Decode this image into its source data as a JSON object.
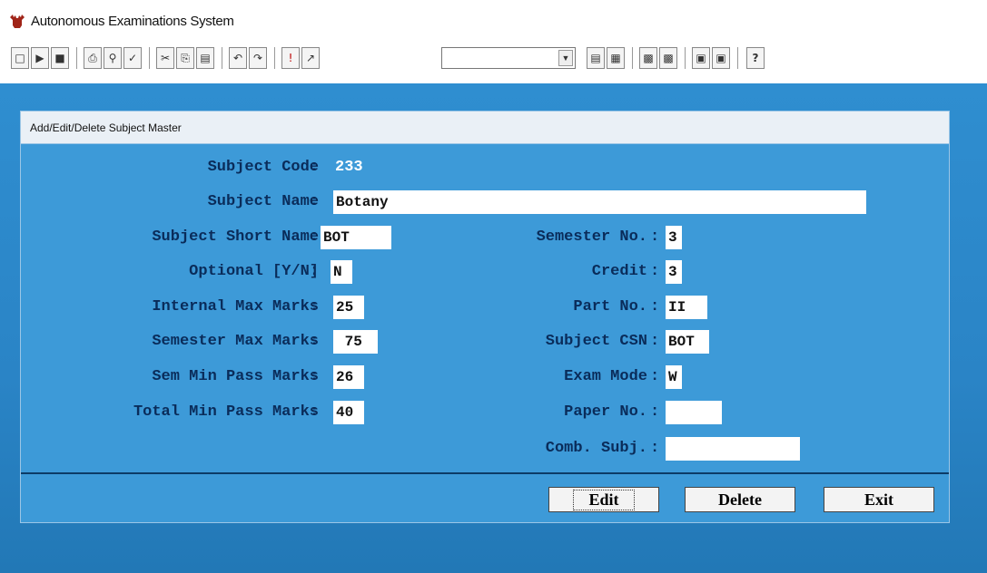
{
  "app": {
    "title": "Autonomous Examinations System",
    "icon": "moose-app-icon"
  },
  "toolbar": {
    "buttons": [
      {
        "name": "new-icon",
        "glyph": "🗋"
      },
      {
        "name": "open-icon",
        "glyph": "📂"
      },
      {
        "name": "save-icon",
        "glyph": "💾"
      },
      {
        "name": "print-icon",
        "glyph": "🖶"
      },
      {
        "name": "print-preview-icon",
        "glyph": "🔍"
      },
      {
        "name": "spell-check-icon",
        "glyph": "✓"
      },
      {
        "name": "cut-icon",
        "glyph": "✂"
      },
      {
        "name": "copy-icon",
        "glyph": "⎘"
      },
      {
        "name": "paste-icon",
        "glyph": "📋"
      },
      {
        "name": "undo-icon",
        "glyph": "↶"
      },
      {
        "name": "redo-icon",
        "glyph": "↷"
      },
      {
        "name": "exclamation-icon",
        "glyph": "!"
      },
      {
        "name": "chart-icon",
        "glyph": "📈"
      },
      {
        "name": "table-icon",
        "glyph": "▤"
      },
      {
        "name": "report-icon",
        "glyph": "▦"
      },
      {
        "name": "record-icon",
        "glyph": "▩"
      },
      {
        "name": "record-alt-icon",
        "glyph": "▩"
      },
      {
        "name": "form-icon",
        "glyph": "▣"
      },
      {
        "name": "form-alt-icon",
        "glyph": "▣"
      },
      {
        "name": "help-icon",
        "glyph": "?"
      }
    ],
    "combo_value": ""
  },
  "dialog": {
    "title": "Add/Edit/Delete Subject Master",
    "fields": {
      "subject_code": {
        "label": "Subject Code",
        "value": "233"
      },
      "subject_name": {
        "label": "Subject Name",
        "value": "Botany"
      },
      "subject_short_name": {
        "label": "Subject Short Name",
        "value": "BOT"
      },
      "optional": {
        "label": "Optional [Y/N]",
        "value": "N"
      },
      "internal_max_marks": {
        "label": "Internal Max Marks",
        "value": "25"
      },
      "semester_max_marks": {
        "label": "Semester Max Marks",
        "value": " 75"
      },
      "sem_min_pass_marks": {
        "label": "Sem Min Pass Marks",
        "value": "26"
      },
      "total_min_pass_marks": {
        "label": "Total Min Pass Marks",
        "value": "40"
      },
      "semester_no": {
        "label": "Semester No.",
        "value": "3"
      },
      "credit": {
        "label": "Credit",
        "value": "3"
      },
      "part_no": {
        "label": "Part No.",
        "value": "II"
      },
      "subject_csn": {
        "label": "Subject CSN",
        "value": "BOT"
      },
      "exam_mode": {
        "label": "Exam Mode",
        "value": "W"
      },
      "paper_no": {
        "label": "Paper No.",
        "value": ""
      },
      "comb_subj": {
        "label": "Comb. Subj.",
        "value": ""
      }
    },
    "colon": ":",
    "buttons": {
      "edit": "Edit",
      "delete": "Delete",
      "exit": "Exit"
    }
  },
  "colors": {
    "dialog_bg": "#3d9ad8",
    "desktop_bg": "#2f8ed0",
    "label": "#0a2c5a",
    "value": "#ffffff"
  }
}
